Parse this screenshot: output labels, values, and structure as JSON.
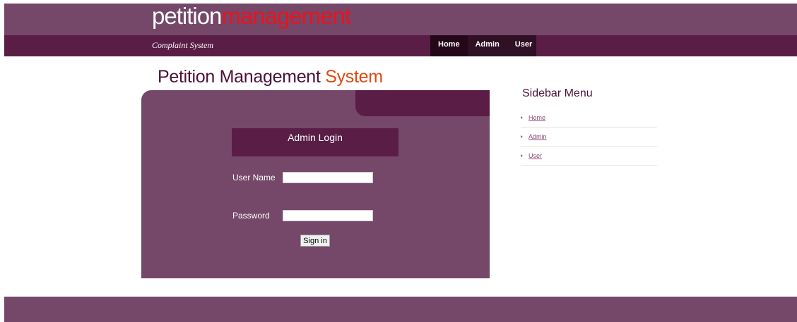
{
  "header": {
    "logo_part1": "petition",
    "logo_part2": "management"
  },
  "navbar": {
    "tagline": "Complaint System",
    "items": [
      {
        "label": "Home",
        "active": true
      },
      {
        "label": "Admin",
        "active": false
      },
      {
        "label": "User",
        "active": false
      }
    ]
  },
  "main": {
    "title_part1": "Petition Management ",
    "title_part2": "System",
    "login": {
      "heading": "Admin Login",
      "username_label": "User Name",
      "username_value": "",
      "password_label": "Password",
      "password_value": "",
      "submit_label": "Sign in"
    }
  },
  "sidebar": {
    "title": "Sidebar Menu",
    "items": [
      {
        "label": "Home"
      },
      {
        "label": "Admin"
      },
      {
        "label": "User"
      }
    ]
  },
  "colors": {
    "primary": "#754869",
    "dark": "#5a1d46",
    "nav_active": "#24081a",
    "accent_red": "#e8141e",
    "accent_orange": "#e04a10"
  },
  "icons": {
    "sidebar_bullet": "triangle-right-icon"
  }
}
